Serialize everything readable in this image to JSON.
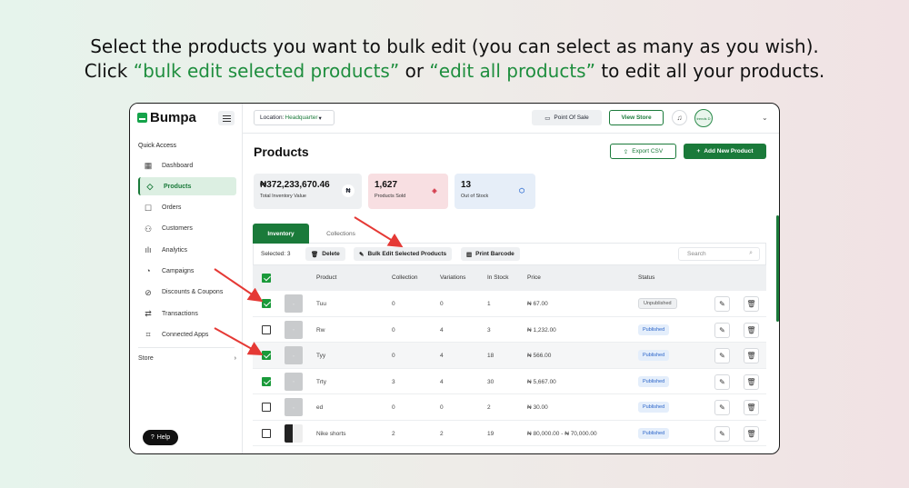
{
  "headline": {
    "line1": "Select the products you want to bulk edit (you can select as many as you wish).",
    "line2_pre": "Click ",
    "line2_hl1": "“bulk edit selected products”",
    "line2_mid": " or ",
    "line2_hl2": "“edit all products”",
    "line2_post": " to edit all your products."
  },
  "app": {
    "name": "Bumpa"
  },
  "sidebar": {
    "section": "Quick Access",
    "items": [
      {
        "label": "Dashboard",
        "icon": "grid-icon"
      },
      {
        "label": "Products",
        "icon": "tag-icon",
        "active": true
      },
      {
        "label": "Orders",
        "icon": "inbox-icon"
      },
      {
        "label": "Customers",
        "icon": "users-icon"
      },
      {
        "label": "Analytics",
        "icon": "bar-chart-icon"
      },
      {
        "label": "Campaigns",
        "icon": "megaphone-icon"
      },
      {
        "label": "Discounts & Coupons",
        "icon": "percent-icon"
      },
      {
        "label": "Transactions",
        "icon": "swap-icon"
      },
      {
        "label": "Connected Apps",
        "icon": "apps-icon"
      }
    ],
    "store_label": "Store",
    "help_label": "Help"
  },
  "topbar": {
    "location_label": "Location:",
    "location_value": "Headquarter",
    "point_of_sale": "Point Of Sale",
    "view_store": "View Store",
    "avatar_text": "trends D"
  },
  "page": {
    "title": "Products",
    "export_csv": "Export CSV",
    "add_new": "Add New Product"
  },
  "stats": [
    {
      "value": "₦372,233,670.46",
      "label": "Total Inventory Value",
      "icon": "naira-icon"
    },
    {
      "value": "1,627",
      "label": "Products Sold",
      "icon": "tag-icon"
    },
    {
      "value": "13",
      "label": "Out of Stock",
      "icon": "box-icon"
    }
  ],
  "tabs": [
    "Inventory",
    "Collections"
  ],
  "toolbar": {
    "selected": "Selected: 3",
    "delete": "Delete",
    "bulk_edit": "Bulk Edit Selected Products",
    "print_barcode": "Print Barcode",
    "search_placeholder": "Search"
  },
  "table": {
    "headers": [
      "Product",
      "Collection",
      "Variations",
      "In Stock",
      "Price",
      "Status"
    ],
    "rows": [
      {
        "checked": true,
        "name": "Tuu",
        "collection": "0",
        "variations": "0",
        "stock": "1",
        "price": "₦ 67.00",
        "status": "Unpublished"
      },
      {
        "checked": false,
        "name": "Rw",
        "collection": "0",
        "variations": "4",
        "stock": "3",
        "price": "₦ 1,232.00",
        "status": "Published"
      },
      {
        "checked": true,
        "name": "Tyy",
        "collection": "0",
        "variations": "4",
        "stock": "18",
        "price": "₦ 566.00",
        "status": "Published"
      },
      {
        "checked": true,
        "name": "Trty",
        "collection": "3",
        "variations": "4",
        "stock": "30",
        "price": "₦ 5,667.00",
        "status": "Published"
      },
      {
        "checked": false,
        "name": "ed",
        "collection": "0",
        "variations": "0",
        "stock": "2",
        "price": "₦ 30.00",
        "status": "Published"
      },
      {
        "checked": false,
        "name": "Nike shorts",
        "collection": "2",
        "variations": "2",
        "stock": "19",
        "price": "₦ 80,000.00 - ₦ 70,000.00",
        "status": "Published"
      }
    ]
  },
  "colors": {
    "brand": "#1a7a3a",
    "arrow": "#e53935",
    "published": "#2a64c8"
  }
}
